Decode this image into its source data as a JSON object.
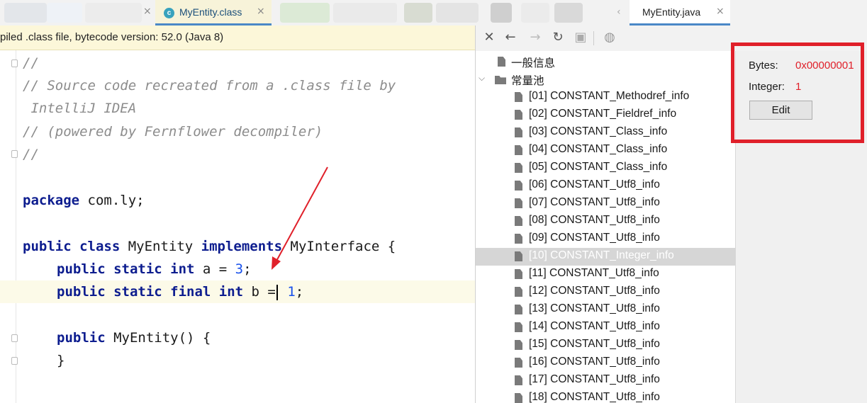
{
  "tabs": {
    "class_tab": {
      "icon": "c",
      "label": "MyEntity.class"
    },
    "java_tab": {
      "label": "MyEntity.java"
    },
    "close_glyph": "×"
  },
  "editor": {
    "banner": "piled .class file, bytecode version: 52.0 (Java 8)",
    "lines": {
      "l1": "//",
      "l2": "// Source code recreated from a .class file by",
      "l3": " IntelliJ IDEA",
      "l4": "// (powered by Fernflower decompiler)",
      "l5": "//",
      "l7_kw": "package",
      "l7_rest": " com.ly;",
      "l9_kw1": "public class",
      "l9_mid": " MyEntity ",
      "l9_kw2": "implements",
      "l9_rest": " MyInterface {",
      "l10_kw": "public static int",
      "l10_mid": " a = ",
      "l10_num": "3",
      "l10_end": ";",
      "l11_kw": "public static final int",
      "l11_mid": " b =",
      "l11_num": " 1",
      "l11_end": ";",
      "l13_kw": "public",
      "l13_rest": " MyEntity() {",
      "l14": "}",
      "l16": "..."
    }
  },
  "toolbar": {
    "icons": [
      "close-icon",
      "back-icon",
      "forward-icon",
      "refresh-icon",
      "save-icon",
      "web-icon"
    ]
  },
  "tree": {
    "general_info": "一般信息",
    "constant_pool": "常量池",
    "items": [
      "[01] CONSTANT_Methodref_info",
      "[02] CONSTANT_Fieldref_info",
      "[03] CONSTANT_Class_info",
      "[04] CONSTANT_Class_info",
      "[05] CONSTANT_Class_info",
      "[06] CONSTANT_Utf8_info",
      "[07] CONSTANT_Utf8_info",
      "[08] CONSTANT_Utf8_info",
      "[09] CONSTANT_Utf8_info",
      "[10] CONSTANT_Integer_info",
      "[11] CONSTANT_Utf8_info",
      "[12] CONSTANT_Utf8_info",
      "[13] CONSTANT_Utf8_info",
      "[14] CONSTANT_Utf8_info",
      "[15] CONSTANT_Utf8_info",
      "[16] CONSTANT_Utf8_info",
      "[17] CONSTANT_Utf8_info",
      "[18] CONSTANT_Utf8_info"
    ],
    "selected_index": 9
  },
  "detail": {
    "bytes_label": "Bytes:",
    "bytes_value": "0x00000001",
    "integer_label": "Integer:",
    "integer_value": "1",
    "edit_button": "Edit"
  },
  "colors": {
    "highlight_red": "#e0202a",
    "keyword": "#0d1d8f",
    "number": "#1750eb",
    "comment": "#8c8c8c",
    "tab_underline": "#4a88c7"
  }
}
